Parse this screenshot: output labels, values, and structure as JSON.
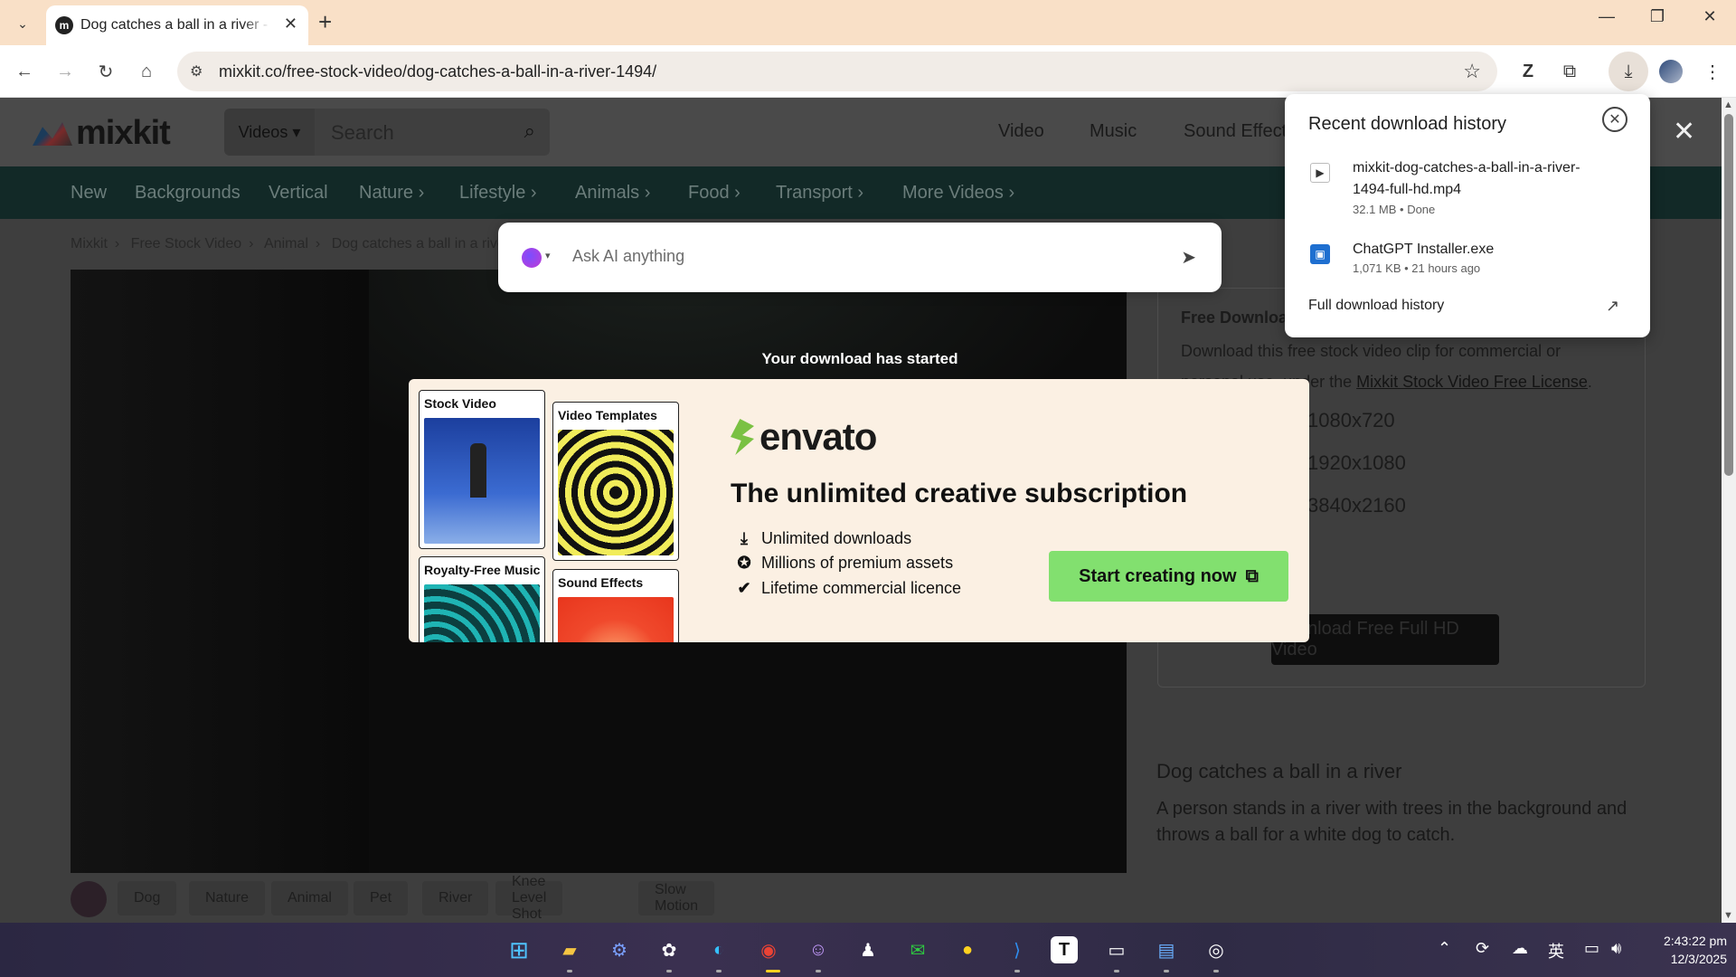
{
  "browser": {
    "tab_title": "Dog catches a ball in a river - Free Stock Video",
    "favicon_letter": "m",
    "url": "mixkit.co/free-stock-video/dog-catches-a-ball-in-a-river-1494/"
  },
  "site": {
    "logo": "mixkit",
    "type_select": "Videos",
    "search_placeholder": "Search",
    "top_nav": [
      "Video",
      "Music",
      "Sound Effects"
    ],
    "categories": [
      "New",
      "Backgrounds",
      "Vertical",
      "Nature",
      "Lifestyle",
      "Animals",
      "Food",
      "Transport",
      "More Videos"
    ],
    "breadcrumbs": [
      "Mixkit",
      "Free Stock Video",
      "Animal",
      "Dog catches a ball in a river"
    ]
  },
  "right_panel": {
    "title": "Free Download",
    "desc_before": "Download this free stock video clip for commercial or personal use, under the ",
    "license_link": "Mixkit Stock Video Free License",
    "desc_after": ".",
    "resolutions": [
      "1080x720",
      "1920x1080",
      "3840x2160"
    ],
    "button": "Download Free Full HD Video"
  },
  "video_info": {
    "title": "Dog catches a ball in a river",
    "description": "A person stands in a river with trees in the background and throws a ball for a white dog to catch."
  },
  "tags": [
    "Dog",
    "Nature",
    "Animal",
    "Pet",
    "River",
    "Knee Level Shot",
    "Slow Motion"
  ],
  "ai_bar": {
    "placeholder": "Ask AI anything"
  },
  "download_notice": "Your download has started",
  "envato": {
    "cards": [
      "Stock Video",
      "Video Templates",
      "Royalty-Free Music",
      "Sound Effects"
    ],
    "logo": "envato",
    "headline": "The unlimited creative subscription",
    "features": [
      "Unlimited downloads",
      "Millions of premium assets",
      "Lifetime commercial licence"
    ],
    "cta": "Start creating now",
    "accent_color": "#82e06f"
  },
  "download_popup": {
    "title": "Recent download history",
    "items": [
      {
        "name": "mixkit-dog-catches-a-ball-in-a-river-1494-full-hd.mp4",
        "meta": "32.1 MB • Done"
      },
      {
        "name": "ChatGPT Installer.exe",
        "meta": "1,071 KB • 21 hours ago"
      }
    ],
    "full_history": "Full download history"
  },
  "clock": {
    "time": "2:43:22 pm",
    "date": "12/3/2025"
  },
  "tray_ime": "英"
}
